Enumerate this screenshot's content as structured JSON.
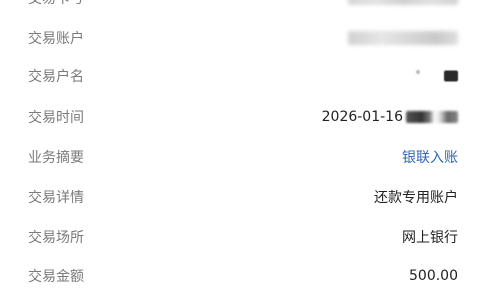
{
  "rows": [
    {
      "label": "交易卡号",
      "value": ""
    },
    {
      "label": "交易账户",
      "value": ""
    },
    {
      "label": "交易户名",
      "value": ""
    },
    {
      "label": "交易时间",
      "value": "2026-01-16"
    },
    {
      "label": "业务摘要",
      "value": "银联入账"
    },
    {
      "label": "交易详情",
      "value": "还款专用账户"
    },
    {
      "label": "交易场所",
      "value": "网上银行"
    },
    {
      "label": "交易金额",
      "value": "500.00"
    }
  ],
  "colors": {
    "label": "#7a7a7a",
    "value": "#222222",
    "link": "#2f66b8",
    "background": "#ffffff"
  }
}
